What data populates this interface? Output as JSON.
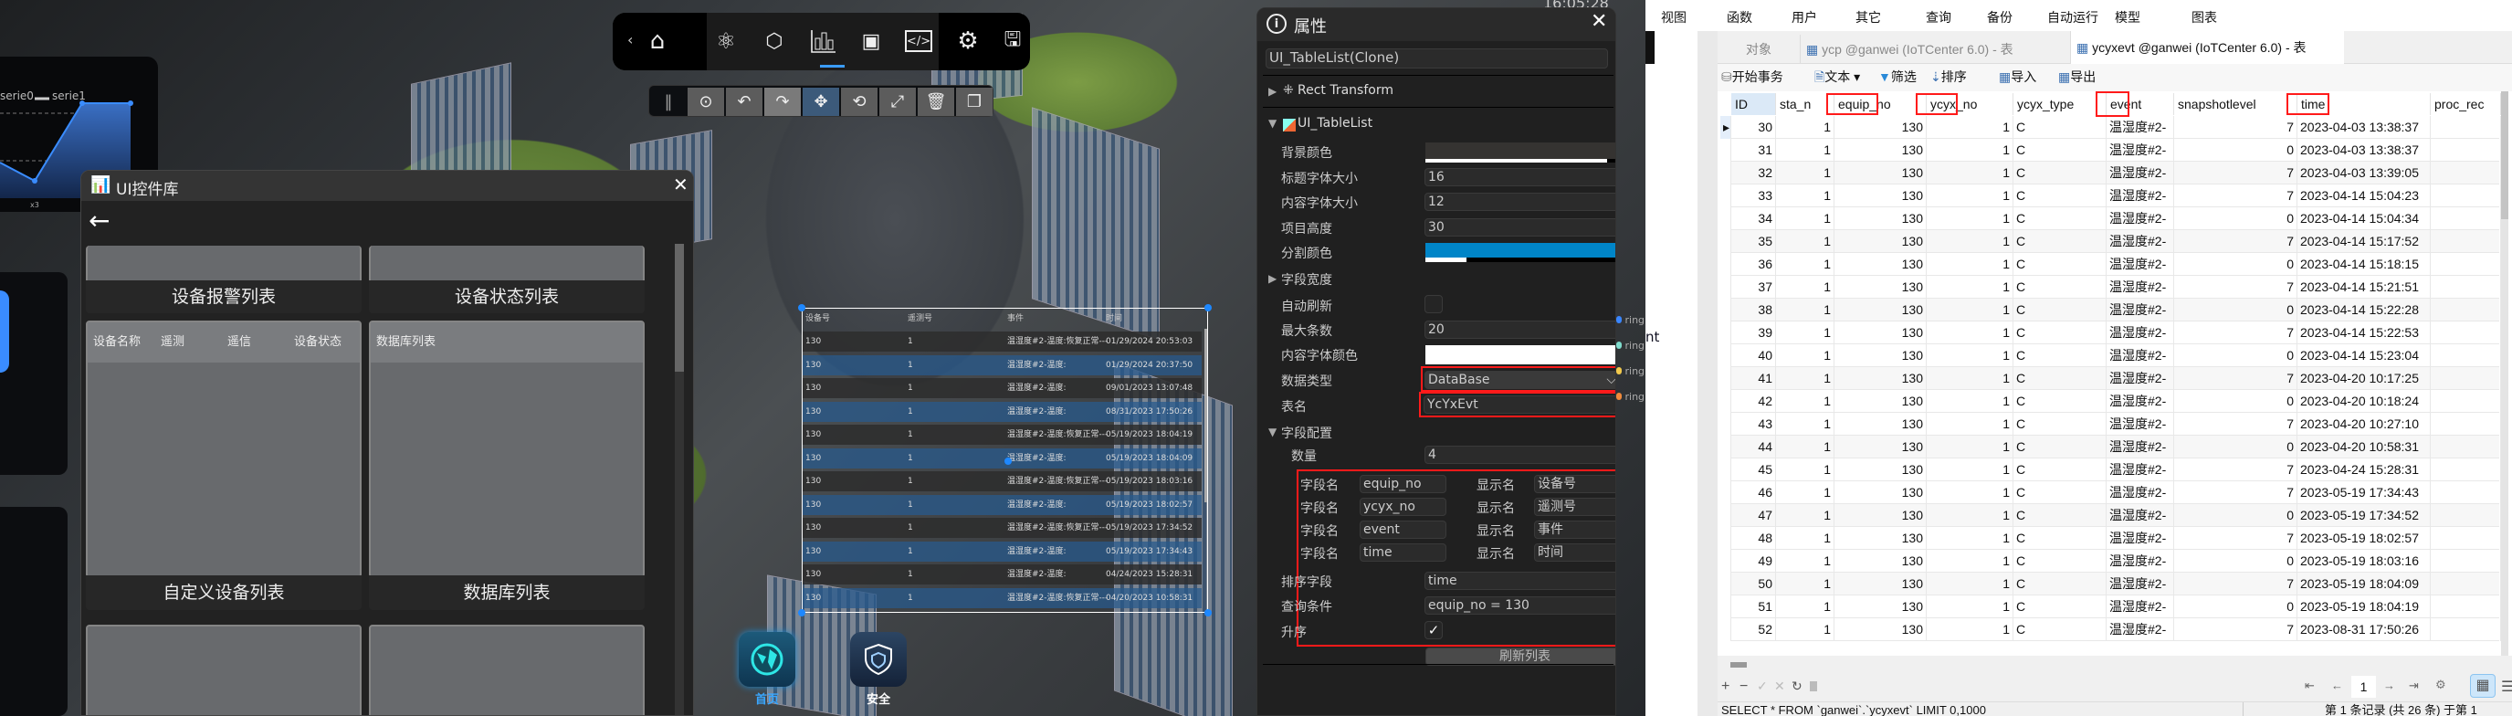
{
  "scene": {
    "clock": "16:05:28",
    "chart": {
      "legend": [
        "serie0",
        "serie1"
      ],
      "xlabel": "x3"
    },
    "rings": [
      "ring:",
      "ring:",
      "ring:",
      "ring:"
    ],
    "ring_colors": [
      "#3a86ff",
      "#7fdccc",
      "#f2c94c",
      "#f08a3c"
    ],
    "ring_overflow": "nt"
  },
  "toolbar": {
    "icons": [
      "home-icon",
      "atom-icon",
      "cube-icon",
      "bar-chart-icon",
      "shapes-icon",
      "code-icon",
      "gear-icon",
      "save-icon"
    ],
    "active": "bar-chart-icon",
    "edit_tools": [
      "drag-handle",
      "target",
      "undo",
      "redo",
      "move",
      "rotate",
      "scale",
      "delete",
      "copy"
    ],
    "active_edit_tool": "move"
  },
  "uilib": {
    "title": "UI控件库",
    "cards": [
      {
        "label": "设备报警列表"
      },
      {
        "label": "设备状态列表"
      },
      {
        "label": "自定义设备列表",
        "headers": [
          "设备名称",
          "遥测",
          "遥信",
          "设备状态"
        ]
      },
      {
        "label": "数据库列表",
        "headers": [
          "数据库列表"
        ]
      }
    ]
  },
  "table3d": {
    "headers": [
      "设备号",
      "遥测号",
      "事件",
      "时间"
    ],
    "rows": [
      [
        "130",
        "1",
        "温湿度#2-温度:恢复正常---",
        "01/29/2024 20:53:03"
      ],
      [
        "130",
        "1",
        "温湿度#2-温度:",
        "01/29/2024 20:37:50"
      ],
      [
        "130",
        "1",
        "温湿度#2-温度:",
        "09/01/2023 13:07:48"
      ],
      [
        "130",
        "1",
        "温湿度#2-温度:",
        "08/31/2023 17:50:26"
      ],
      [
        "130",
        "1",
        "温湿度#2-温度:恢复正常---",
        "05/19/2023 18:04:19"
      ],
      [
        "130",
        "1",
        "温湿度#2-温度:",
        "05/19/2023 18:04:09"
      ],
      [
        "130",
        "1",
        "温湿度#2-温度:恢复正常---",
        "05/19/2023 18:03:16"
      ],
      [
        "130",
        "1",
        "温湿度#2-温度:",
        "05/19/2023 18:02:57"
      ],
      [
        "130",
        "1",
        "温湿度#2-温度:恢复正常---",
        "05/19/2023 17:34:52"
      ],
      [
        "130",
        "1",
        "温湿度#2-温度:",
        "05/19/2023 17:34:43"
      ],
      [
        "130",
        "1",
        "温湿度#2-温度:",
        "04/24/2023 15:28:31"
      ],
      [
        "130",
        "1",
        "温湿度#2-温度:恢复正常---",
        "04/20/2023 10:58:31"
      ]
    ]
  },
  "bottom_nav": [
    {
      "label": "首页",
      "icon": "globe-icon",
      "active": true
    },
    {
      "label": "安全",
      "icon": "shield-icon",
      "active": false
    }
  ],
  "props": {
    "title": "属性",
    "object_name": "UI_TableList(Clone)",
    "rect_transform": "Rect Transform",
    "component": "UI_TableList",
    "bg_color_label": "背景颜色",
    "bg_color": "#353331",
    "title_font_label": "标题字体大小",
    "title_font": "16",
    "content_font_label": "内容字体大小",
    "content_font": "12",
    "item_height_label": "项目高度",
    "item_height": "30",
    "divider_color_label": "分割颜色",
    "divider_color": "#0085c8",
    "field_width_label": "字段宽度",
    "auto_refresh_label": "自动刷新",
    "auto_refresh": false,
    "max_items_label": "最大条数",
    "max_items": "20",
    "content_color_label": "内容字体颜色",
    "content_color": "#ffffff",
    "data_type_label": "数据类型",
    "data_type": "DataBase",
    "table_name_label": "表名",
    "table_name": "YcYxEvt",
    "field_config_label": "字段配置",
    "count_label": "数量",
    "count": "4",
    "field_label": "字段名",
    "display_label": "显示名",
    "fields": [
      {
        "name": "equip_no",
        "display": "设备号"
      },
      {
        "name": "ycyx_no",
        "display": "遥测号"
      },
      {
        "name": "event",
        "display": "事件"
      },
      {
        "name": "time",
        "display": "时间"
      }
    ],
    "sort_label": "排序字段",
    "sort": "time",
    "query_label": "查询条件",
    "query": "equip_no = 130",
    "asc_label": "升序",
    "asc": true,
    "refresh_button": "刷新列表"
  },
  "navicat": {
    "menu": [
      "视图",
      "函数",
      "用户",
      "其它",
      "查询",
      "备份",
      "自动运行",
      "模型",
      "图表"
    ],
    "tabs": [
      "对象",
      "ycp @ganwei (IoTCenter 6.0) - 表",
      "ycyxevt @ganwei (IoTCenter 6.0) - 表"
    ],
    "active_tab": 2,
    "toolbar": [
      "开始事务",
      "文本",
      "筛选",
      "排序",
      "导入",
      "导出"
    ],
    "columns": [
      "ID",
      "sta_n",
      "equip_no",
      "ycyx_no",
      "ycyx_type",
      "event",
      "snapshotlevel",
      "time",
      "proc_rec"
    ],
    "rows": [
      [
        "30",
        "1",
        "130",
        "1",
        "C",
        "温湿度#2-",
        "7",
        "2023-04-03 13:38:37"
      ],
      [
        "31",
        "1",
        "130",
        "1",
        "C",
        "温湿度#2-",
        "0",
        "2023-04-03 13:38:37"
      ],
      [
        "32",
        "1",
        "130",
        "1",
        "C",
        "温湿度#2-",
        "7",
        "2023-04-03 13:39:05"
      ],
      [
        "33",
        "1",
        "130",
        "1",
        "C",
        "温湿度#2-",
        "7",
        "2023-04-14 15:04:23"
      ],
      [
        "34",
        "1",
        "130",
        "1",
        "C",
        "温湿度#2-",
        "0",
        "2023-04-14 15:04:34"
      ],
      [
        "35",
        "1",
        "130",
        "1",
        "C",
        "温湿度#2-",
        "7",
        "2023-04-14 15:17:52"
      ],
      [
        "36",
        "1",
        "130",
        "1",
        "C",
        "温湿度#2-",
        "0",
        "2023-04-14 15:18:15"
      ],
      [
        "37",
        "1",
        "130",
        "1",
        "C",
        "温湿度#2-",
        "7",
        "2023-04-14 15:21:51"
      ],
      [
        "38",
        "1",
        "130",
        "1",
        "C",
        "温湿度#2-",
        "0",
        "2023-04-14 15:22:28"
      ],
      [
        "39",
        "1",
        "130",
        "1",
        "C",
        "温湿度#2-",
        "7",
        "2023-04-14 15:22:53"
      ],
      [
        "40",
        "1",
        "130",
        "1",
        "C",
        "温湿度#2-",
        "0",
        "2023-04-14 15:23:04"
      ],
      [
        "41",
        "1",
        "130",
        "1",
        "C",
        "温湿度#2-",
        "7",
        "2023-04-20 10:17:25"
      ],
      [
        "42",
        "1",
        "130",
        "1",
        "C",
        "温湿度#2-",
        "0",
        "2023-04-20 10:18:24"
      ],
      [
        "43",
        "1",
        "130",
        "1",
        "C",
        "温湿度#2-",
        "7",
        "2023-04-20 10:27:10"
      ],
      [
        "44",
        "1",
        "130",
        "1",
        "C",
        "温湿度#2-",
        "0",
        "2023-04-20 10:58:31"
      ],
      [
        "45",
        "1",
        "130",
        "1",
        "C",
        "温湿度#2-",
        "7",
        "2023-04-24 15:28:31"
      ],
      [
        "46",
        "1",
        "130",
        "1",
        "C",
        "温湿度#2-",
        "7",
        "2023-05-19 17:34:43"
      ],
      [
        "47",
        "1",
        "130",
        "1",
        "C",
        "温湿度#2-",
        "0",
        "2023-05-19 17:34:52"
      ],
      [
        "48",
        "1",
        "130",
        "1",
        "C",
        "温湿度#2-",
        "7",
        "2023-05-19 18:02:57"
      ],
      [
        "49",
        "1",
        "130",
        "1",
        "C",
        "温湿度#2-",
        "0",
        "2023-05-19 18:03:16"
      ],
      [
        "50",
        "1",
        "130",
        "1",
        "C",
        "温湿度#2-",
        "7",
        "2023-05-19 18:04:09"
      ],
      [
        "51",
        "1",
        "130",
        "1",
        "C",
        "温湿度#2-",
        "0",
        "2023-05-19 18:04:19"
      ],
      [
        "52",
        "1",
        "130",
        "1",
        "C",
        "温湿度#2-",
        "7",
        "2023-08-31 17:50:26"
      ]
    ],
    "page": "1",
    "sql": "SELECT * FROM `ganwei`.`ycyxevt` LIMIT 0,1000",
    "status": "第 1 条记录 (共 26 条) 于第 1"
  }
}
